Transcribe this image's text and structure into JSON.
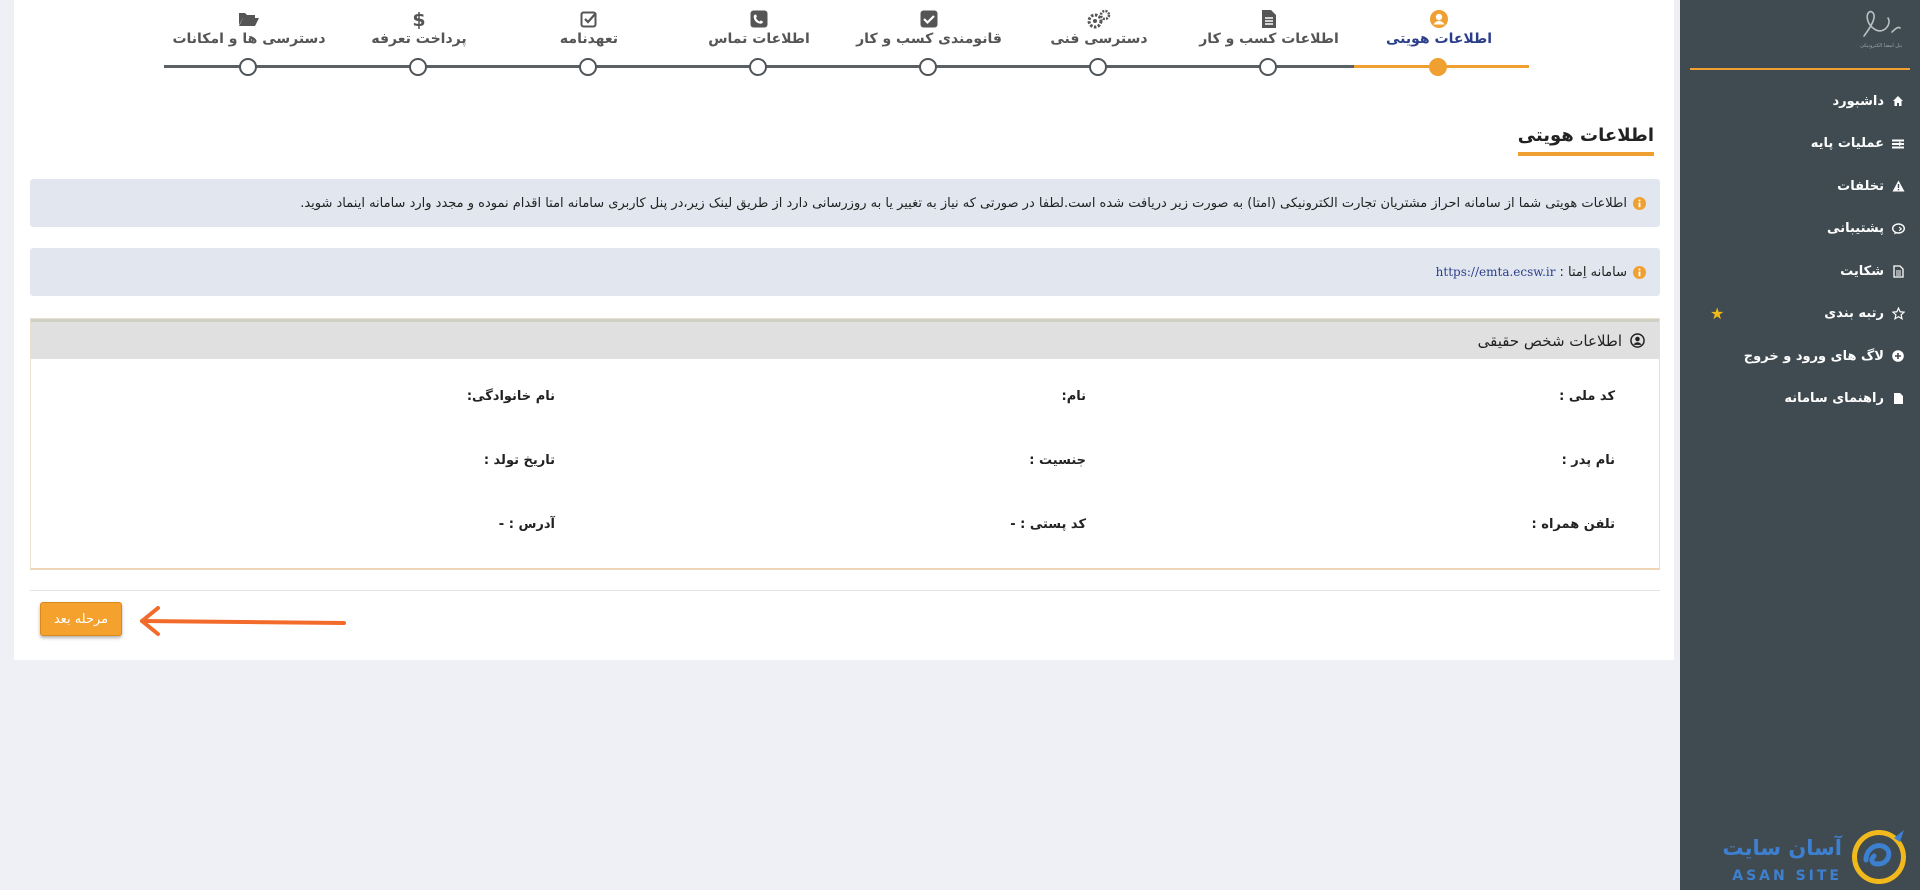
{
  "sidebar": {
    "logo_caption": "پنل امضا الکترونیکی",
    "items": [
      {
        "label": "داشبورد",
        "icon": "home-icon",
        "has_children": false
      },
      {
        "label": "عملیات پایه",
        "icon": "list-icon",
        "has_children": true
      },
      {
        "label": "تخلفات",
        "icon": "warning-icon",
        "has_children": false
      },
      {
        "label": "پشتیبانی",
        "icon": "chat-icon",
        "has_children": true
      },
      {
        "label": "شکایت",
        "icon": "document-icon",
        "has_children": false
      },
      {
        "label": "رتبه بندی",
        "icon": "star-outline-icon",
        "has_children": false,
        "starred": true
      },
      {
        "label": "لاگ های ورود و خروج",
        "icon": "plus-circle-icon",
        "has_children": false
      },
      {
        "label": "راهنمای سامانه",
        "icon": "file-icon",
        "has_children": true
      }
    ],
    "brand_fa": "آسان سایت",
    "brand_en": "ASAN SITE"
  },
  "stepper": {
    "active_index": 0,
    "steps": [
      {
        "label": "اطلاعات هویتی",
        "icon": "user-circle-icon"
      },
      {
        "label": "اطلاعات کسب و کار",
        "icon": "file-text-icon"
      },
      {
        "label": "دسترسی فنی",
        "icon": "gears-icon"
      },
      {
        "label": "قانومندی کسب و کار",
        "icon": "check-square-icon"
      },
      {
        "label": "اطلاعات تماس",
        "icon": "phone-square-icon"
      },
      {
        "label": "تعهدنامه",
        "icon": "check-square-outline-icon"
      },
      {
        "label": "پرداخت تعرفه",
        "icon": "dollar-icon"
      },
      {
        "label": "دسترسی ها و امکانات",
        "icon": "folder-open-icon"
      }
    ]
  },
  "page": {
    "title": "اطلاعات هویتی",
    "info_text": "اطلاعات هویتی شما از سامانه احراز مشتریان تجارت الکترونیکی (امتا) به صورت زیر دریافت شده است.لطفا در صورتی که نیاز به تغییر یا به روزرسانی دارد از طریق لینک زیر،در پنل کاربری سامانه امتا اقدام نموده و مجدد وارد سامانه اینماد شوید.",
    "emta_label": "سامانه اِمتا :",
    "emta_link": "https://emta.ecsw.ir"
  },
  "card": {
    "title": "اطلاعات شخص حقیقی",
    "fields": {
      "national_code": "کد ملی :",
      "first_name": "نام:",
      "last_name": "نام خانوادگی:",
      "father_name": "نام پدر :",
      "gender": "جنسیت :",
      "birth_date": "تاریخ تولد :",
      "mobile": "تلفن همراه :",
      "postal_code": "کد پستی : -",
      "address": "آدرس : -"
    }
  },
  "next_button": "مرحله بعد",
  "colors": {
    "accent": "#f0a030",
    "sidebar": "#3f4b50",
    "link": "#2a3e8a"
  }
}
